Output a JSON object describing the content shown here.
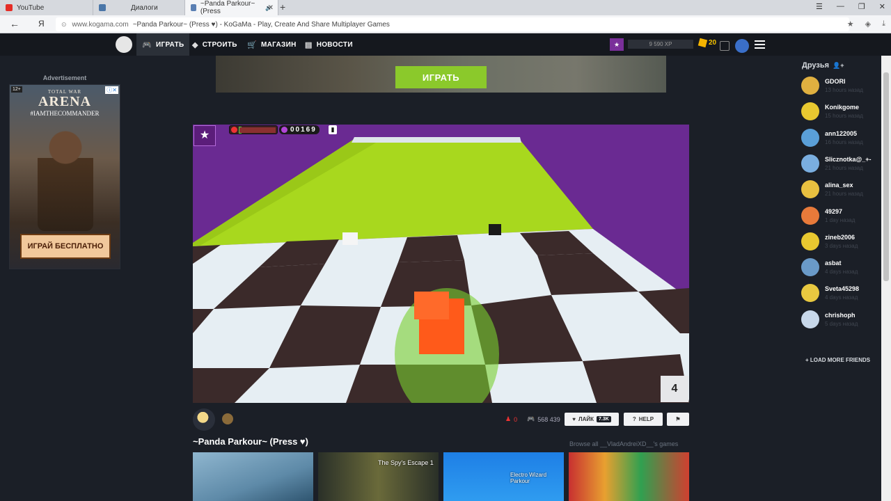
{
  "browser": {
    "tabs": [
      {
        "label": "YouTube",
        "color": "#e52d27"
      },
      {
        "label": "Диалоги",
        "color": "#4a76a8"
      },
      {
        "label": "~Panda Parkour~ (Press",
        "color": "#5a7fb3"
      }
    ],
    "address": {
      "domain": "www.kogama.com",
      "title": "~Panda Parkour~ (Press ♥) - KoGaMa - Play, Create And Share Multiplayer Games",
      "ya": "Я"
    }
  },
  "nav": {
    "items": [
      "ИГРАТЬ",
      "СТРОИТЬ",
      "МАГАЗИН",
      "НОВОСТИ"
    ],
    "xp": "9 590 XP",
    "gold": "20"
  },
  "banner": {
    "button": "ИГРАТЬ"
  },
  "ad": {
    "label": "Advertisement",
    "rating": "12+",
    "brand_small": "TOTAL WAR",
    "brand_big": "ARENA",
    "hashtag": "#IAMTHECOMMANDER",
    "cta": "ИГРАЙ БЕСПЛАТНО"
  },
  "game": {
    "gold": "00169",
    "counter": "4",
    "title": "~Panda Parkour~ (Press ♥)",
    "likes": "0",
    "plays": "568 439",
    "like_label": "ЛАЙК",
    "like_count": "7.3K",
    "help_label": "HELP",
    "browse": "Browse all __VladAndreiXD__'s games"
  },
  "thumbnails": [
    {
      "label": ""
    },
    {
      "label": "The Spy's Escape 1"
    },
    {
      "label": "Electro Wizard Parkour"
    },
    {
      "label": ""
    }
  ],
  "friends": {
    "title": "Друзья",
    "items": [
      {
        "name": "GDORI",
        "time": "13 hours назад",
        "color": "#e0b040"
      },
      {
        "name": "Konikgome",
        "time": "15 hours назад",
        "color": "#e8c830"
      },
      {
        "name": "ann122005",
        "time": "16 hours назад",
        "color": "#5a9fd8"
      },
      {
        "name": "Slicznotka@_+-",
        "time": "21 hours назад",
        "color": "#7aaee0"
      },
      {
        "name": "alina_sex",
        "time": "21 hours назад",
        "color": "#e8c040"
      },
      {
        "name": "49297",
        "time": "1 day назад",
        "color": "#e87a3a"
      },
      {
        "name": "zineb2006",
        "time": "3 days назад",
        "color": "#e8c830"
      },
      {
        "name": "asbat",
        "time": "4 days назад",
        "color": "#6a9ac8"
      },
      {
        "name": "Sveta45298",
        "time": "4 days назад",
        "color": "#e8c840"
      },
      {
        "name": "chrishoph",
        "time": "5 days назад",
        "color": "#c8d8ea"
      }
    ],
    "load_more": "+ LOAD MORE FRIENDS"
  },
  "colors": {
    "accent_green": "#8bc92b",
    "nav_bg": "#15181e",
    "page_bg": "#1b1f27",
    "level_purple": "#7a2f9a"
  }
}
